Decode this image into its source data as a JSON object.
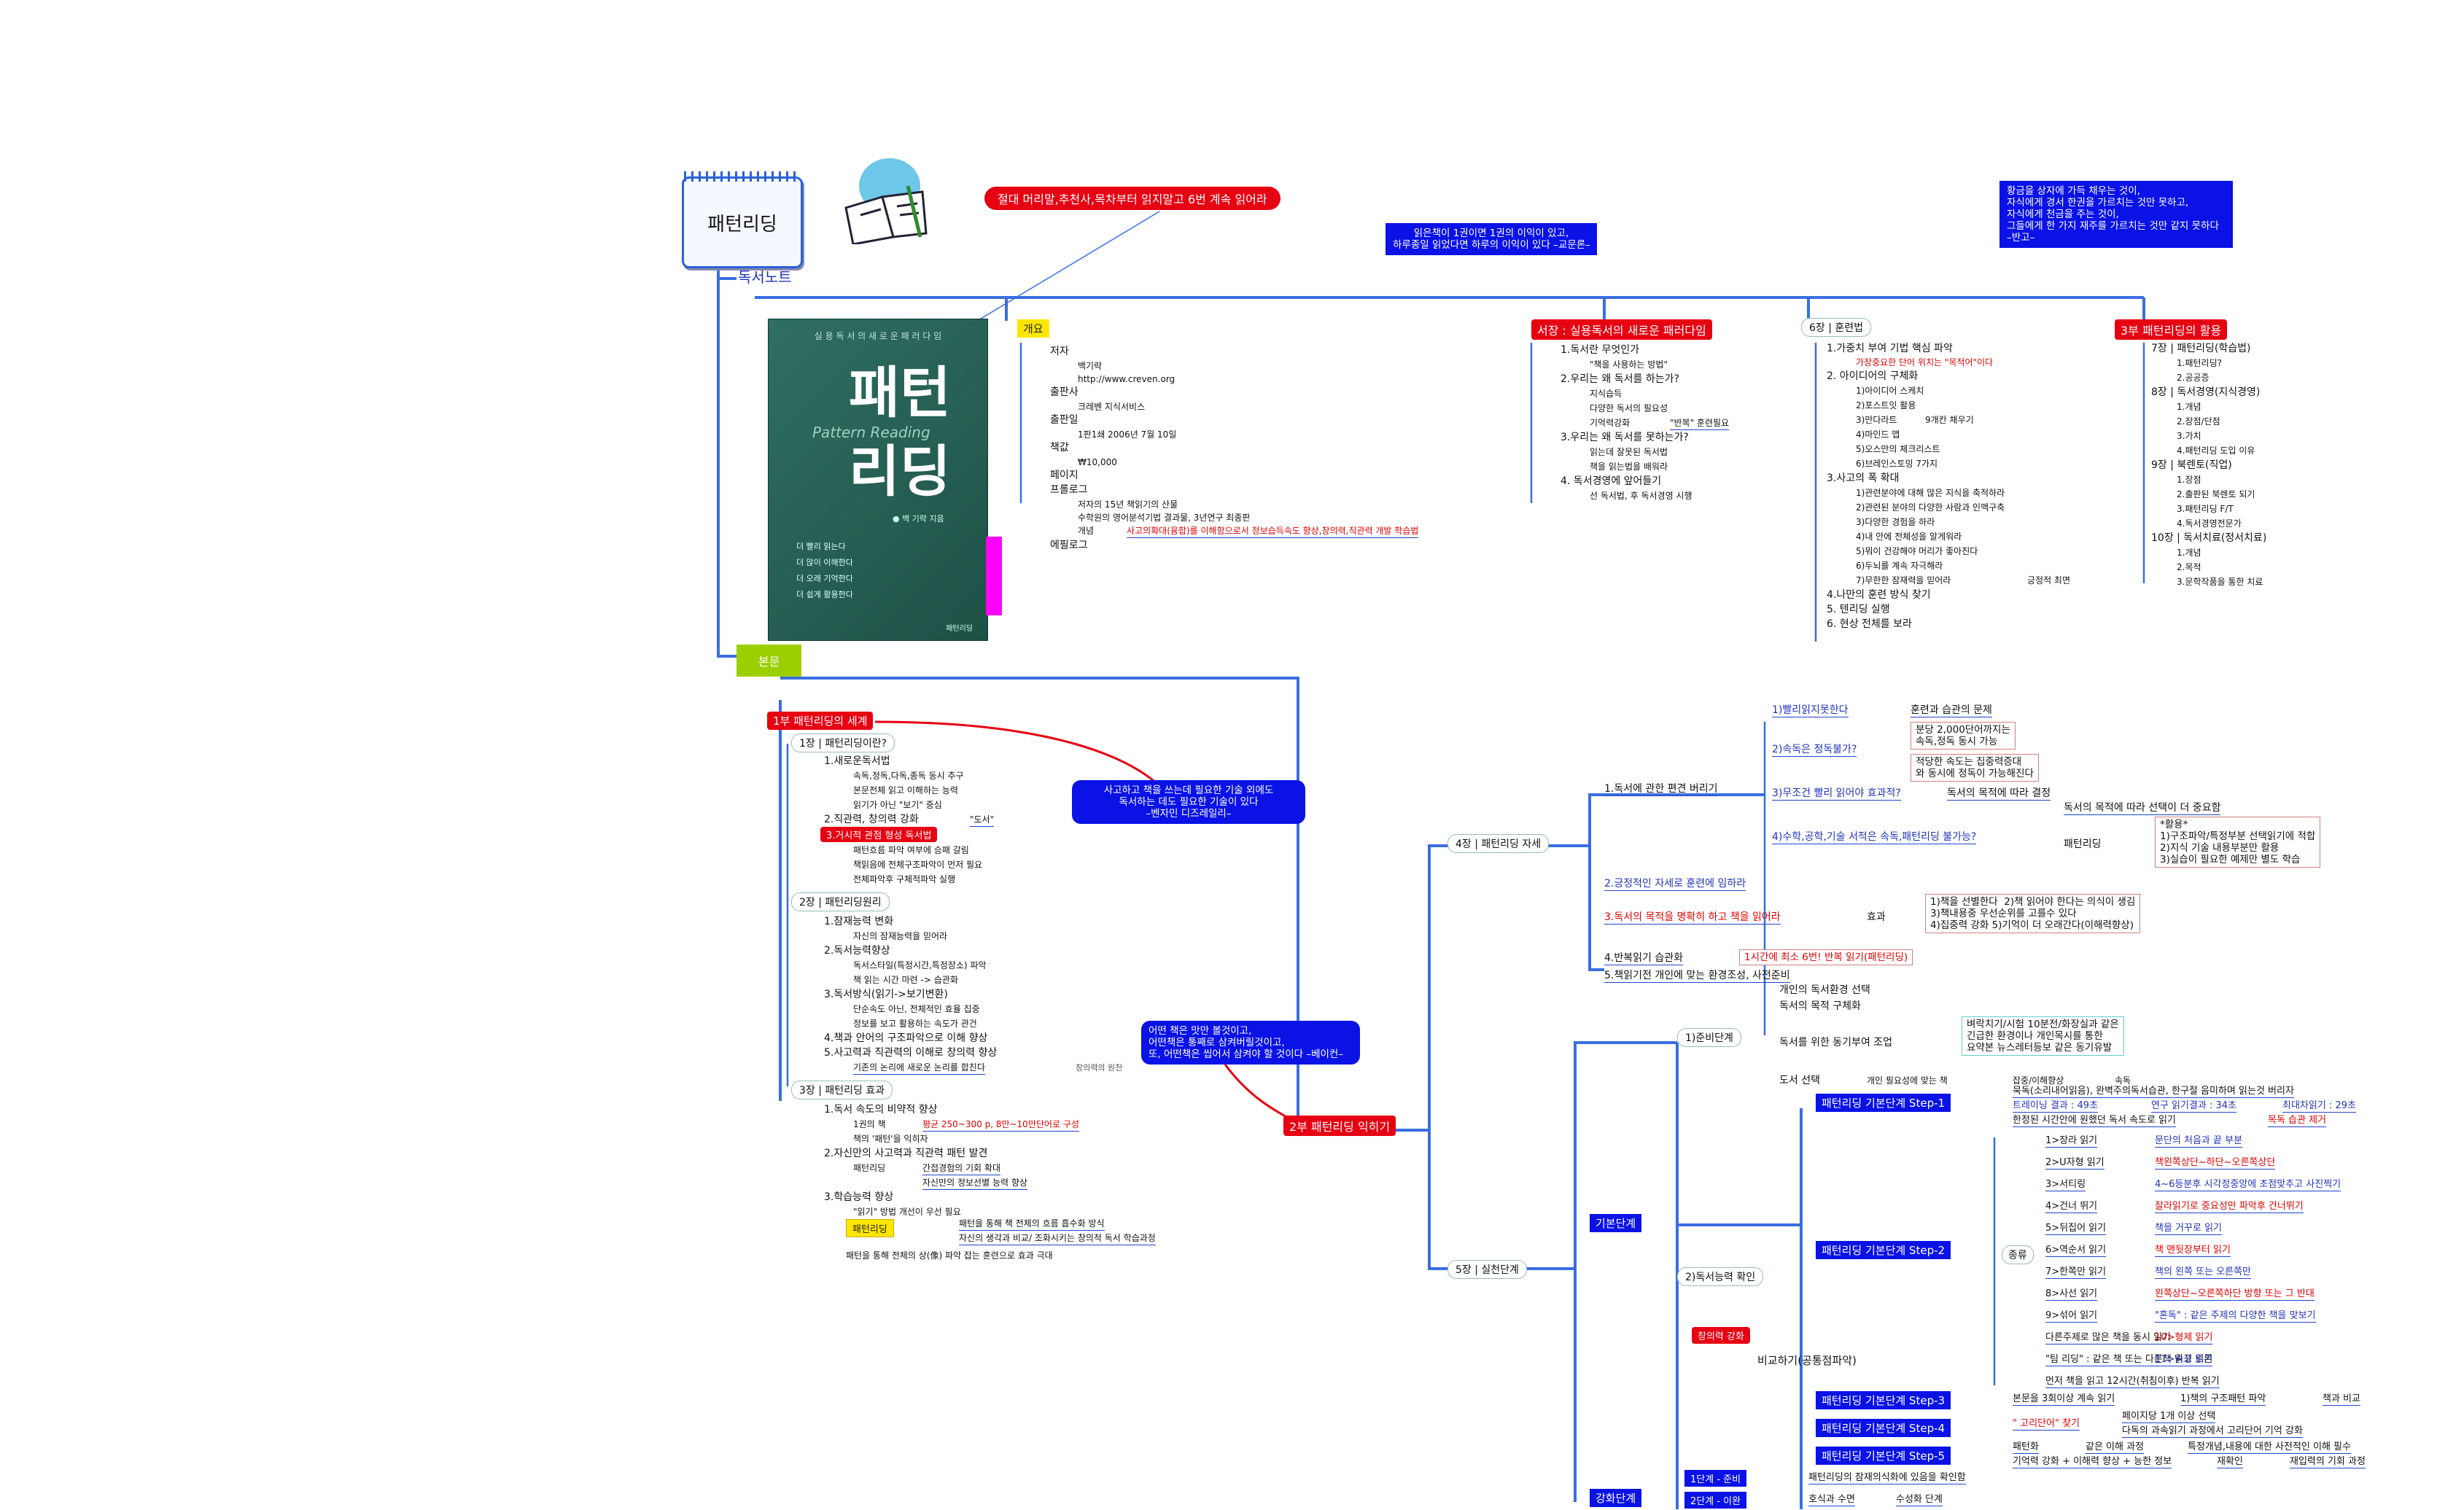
{
  "root": {
    "title": "패턴리딩",
    "child": "독서노트",
    "main": "본문"
  },
  "top_notes": {
    "red_banner": "절대 머리말,추천사,목차부터 읽지말고 6번 계속 읽어라",
    "blue_quote1": "읽은책이 1권이면 1권의 이익이 있고,\n하루종일 읽었다면 하루의 이익이 있다 –교문론–",
    "blue_quote2": "황금을 상자에 가득 채우는 것이,\n자식에게 경서 한권을 가르치는 것만 못하고,\n자식에게 천금을 주는 것이,\n그들에게 한 가지 재주를 가르치는 것만 같지 못하다\n–반고–"
  },
  "book": {
    "top": "실 용 독 서 의 새 로 운 패 러 다 임",
    "title1": "패턴",
    "title2": "리딩",
    "english": "Pattern Reading",
    "author": "● 백 기락 지음",
    "bullets": [
      "더 빨리 읽는다",
      "더 많이 이해한다",
      "더 오래 기억한다",
      "더 쉽게 활용한다"
    ],
    "publisher": "패턴리딩"
  },
  "overview": {
    "label": "개요",
    "items": [
      "저자",
      "백기락",
      "http://www.creven.org",
      "출판사",
      "크레벤 지식서비스",
      "출판일",
      "1판1쇄 2006년 7월 10일",
      "책값",
      "₩10,000",
      "페이지",
      "프롤로그",
      "저자의 15년 책읽기의 산물",
      "수학원의 영어분석기법 결과물, 3년연구 최종판",
      "개념",
      "사고의확대(융합)를 이해함으로서 정보습득속도 향상,창의력,직관력 개발 학습법",
      "에필로그"
    ]
  },
  "intro": {
    "label": "서장 : 실용독서의 새로운 패러다임",
    "items": [
      "1.독서란 무엇인가",
      "\"책을 사용하는 방법\"",
      "2.우리는 왜 독서를 하는가?",
      "지식습득",
      "다양한 독서의 필요성",
      "기억력강화",
      "\"반복\" 훈련필요",
      "3.우리는 왜 독서를 못하는가?",
      "읽는데 잘못된 독서법",
      "책을 읽는법을 배워라",
      "4. 독서경영에 앞어들기",
      "선 독서법, 후 독서경영 시행"
    ]
  },
  "ch6": {
    "label": "6장 | 훈련법",
    "items": [
      "1.가중치 부여 기법 핵심 파악",
      "가장중요한 단어 위치는 \"목적어\"이다",
      "2. 아이디어의 구체화",
      "1)아이디어 스케치",
      "2)포스트잇 활용",
      "3)만다라트",
      "9개칸 채우기",
      "4)마인드 맵",
      "5)오스만의 체크리스트",
      "6)브레인스토밍 7가지",
      "3.사고의 폭 확대",
      "1)관련분야에 대해 많은 지식을 축적하라",
      "2)관련된 분야의 다양한 사람과 인맥구축",
      "3)다양한 경험을 하라",
      "4)내 안에 전체성을 알게워라",
      "5)뭐이 건강해야 머리가 좋아진다",
      "6)두뇌를 계속 자극해라",
      "7)무한한 잠재력을 믿어라",
      "긍정적 최면",
      "4.나만의 훈련 방식 찾기",
      "5. 텐리딩 실행",
      "6. 현상 전체를 보라"
    ]
  },
  "part3": {
    "label": "3부 패턴리딩의 활용",
    "items": [
      "7장 | 패턴리딩(학습법)",
      "1.패턴리딩?",
      "2.공공증",
      "8장 | 독서경영(지식경영)",
      "1.개념",
      "2.장점/단점",
      "3.가치",
      "4.패턴리딩 도입 이유",
      "9장 | 북렌토(직업)",
      "1.장점",
      "2.출판된 북렌토 되기",
      "3.패턴리딩 F/T",
      "4.독서경영전문가",
      "10장 | 독서치료(정서치료)",
      "1.개념",
      "2.목적",
      "3.문학작품을 통한 치료"
    ]
  },
  "part1": {
    "label": "1부 패턴리딩의 세계",
    "ch1": "1장 | 패턴리딩이란?",
    "ch1_items": [
      "1.새로운독서법",
      "속독,정독,다독,종독 동시 추구",
      "본문전체 읽고 이해하는 능력",
      "읽기가 아닌 \"보기\" 중심",
      "2.직관력, 창의력 강화",
      "\"도서\"",
      "3.거시적 관점 형성 독서법",
      "패턴흐름 파악 여부에 승패 갈림",
      "책읽음에 전체구조파악이 먼저 필요",
      "전체파악후 구체적파악 실행"
    ],
    "ch2": "2장 | 패턴리딩원리",
    "ch2_items": [
      "1.잠재능력 변화",
      "자신의 잠재능력을 믿어라",
      "2.독서능력향상",
      "독서스타일(특정시간,특정장소) 파악",
      "책 읽는 시간 마련 -> 습관화",
      "3.독서방식(읽기->보기변환)",
      "단순속도 아닌, 전체적인 효율 집중",
      "정보를 보고 활용하는 속도가 관건",
      "4.책과 안어의 구조파악으로 이해 향상",
      "5.사고력과 직관력의 이해로 창의력 향상",
      "기존의 논리에 새로운 논리를 합친다",
      "창의력의 원천"
    ],
    "ch3": "3장 | 패턴리딩 효과",
    "ch3_items": [
      "1.독서 속도의 비약적 향상",
      "1권의 책",
      "평균 250~300 p, 8만~10만단어로 구성",
      "책의 '패턴'을 익히자",
      "2.자신만의 사고력과 직관력 패턴 발견",
      "패턴리딩",
      "간접경험의 기회 확대",
      "자신만의 정보선별 능력 향상",
      "3.학습능력 향상",
      "\"읽기\" 방법 개선이 우선 필요",
      "패턴리딩",
      "패턴을 통해 책 전체의 흐름 흡수화 방식",
      "자신의 생각과 비교/ 조화시키는 창의적 독서 학습과정",
      "패턴을 통해 전체의 상(像) 파악 잡는 훈련으로 효과 극대"
    ]
  },
  "mid_notes": {
    "quote_a": "사고하고 책을 쓰는데 필요한 기술 외에도\n독서하는 데도 필요한 기술이 있다\n–벤자민 디즈레일리–",
    "quote_b": "어떤 책은 맛만 볼것이고,\n어떤책은 통째로 삼켜버릴것이고,\n또, 어떤책은 씹어서 삼켜야 할 것이다 –베이컨–"
  },
  "part2": {
    "label": "2부 패턴리딩 익히기"
  },
  "ch4": {
    "label": "4장 | 패턴리딩 자세",
    "b1": "1.독서에 관한 편견 버리기",
    "b1_items": [
      "1)빨리읽지못한다",
      "훈련과 습관의 문제",
      "2)속독은 정독불가?",
      "3)무조건 빨리 읽어야 효과적?",
      "독서의 목적에 따라 결정",
      "4)수학,공학,기술 서적은 속독,패턴리딩 불가능?",
      "독서의 목적에 따라 선택이 더 중요함",
      "패턴리딩"
    ],
    "box1": "분당 2,000단어까지는\n속독,정독 동시 가능",
    "box2": "적당한 속도는 집중력증대\n와 동시에 정독이 가능해진다",
    "box3": "*활용*\n1)구조파악/특정부분 선택읽기에 적합\n2)지식 기술 내용부분만 활용\n3)실습이 필요한 예제만 별도 학습",
    "b2": "2.긍정적인 자세로 훈련에 임하라",
    "b3": "3.독서의 목적을 명확히 하고 책을 읽어라",
    "b3_effect": "효과",
    "box4": "1)책을 선별한다  2)책 읽어야 한다는 의식이 생김\n3)책내용중 우선순위를 고를수 있다\n4)집중력 강화 5)기억이 더 오래간다(이해력향상)",
    "b4": "4.반복읽기 습관화",
    "b4_box": "1시간에 최소 6번! 반복 읽기(패턴리딩)",
    "b5": "5.책읽기전 개인에 맞는 환경조성, 사전준비"
  },
  "ch5": {
    "label": "5장 | 실천단계",
    "prep": "1)준비단계",
    "prep_items": [
      "개인의 독서환경 선택",
      "독서의 목적 구체화",
      "독서를 위한 동기부여 조업",
      "도서 선택",
      "개인 필요성에 맞는 책",
      "잡중/이해향상",
      "속독"
    ],
    "prep_box": "벼락치기/시험 10분전/화장실과 같은\n긴급한 환경이나 개인목시를 통한\n요약본 뉴스레터등보 같은 동기유발",
    "basic": "기본단계",
    "skill": "2)독서능력 확인",
    "s1": "패턴리딩 기본단계 Step-1",
    "s1_items": [
      "묵독(소리내어읽음), 완벽주의독서습관, 한구절 음미하며 읽는것 버리자",
      "트레이닝 결과 : 49초",
      "연구 읽기결과 : 34초",
      "최대차읽기 : 29초",
      "한정된 시간안에 원했던 독서 속도로 읽기",
      "목독 습관 제거"
    ],
    "s2": "패턴리딩 기본단계 Step-2",
    "s2_kind": "종류",
    "s2_items": [
      "1>장라 읽기",
      "문단의 처음과 끝 부분",
      "2>U자형 읽기",
      "책왼쪽상단~하단~오른쪽상단",
      "3>서티링",
      "4~6등분후 시각정중앙에 초점맞추고 사진찍기",
      "4>건너 뛰기",
      "잘라읽기로 중요성만 파악후 건너뛰기",
      "5>뒤집어 읽기",
      "책을 거꾸로 읽기",
      "6>역순서 읽기",
      "책 맨뒷장부터 읽기",
      "7>한쪽만 읽기",
      "책의 왼쪽 또는 오른쪽만",
      "8>사선 읽기",
      "왼쪽상단~오른쪽하단 방향 또는 그 반대",
      "9>섞어 읽기",
      "\"혼독\" : 같은 주제의 다양한 책을 맞보기",
      "다른주제로 많은 책을 동시 읽기",
      "10>형제 읽기",
      "\"팀 리딩\" : 같은 책 또는 다른책 읽고 토론",
      "11>속성 읽기",
      "먼저 책을 읽고 12시간(취침이후) 반복 읽기"
    ],
    "creative": "창의력 강화",
    "compare": "비교하기(공통점파악)",
    "s3": "패턴리딩 기본단계 Step-3",
    "s3_items": [
      "본문을 3회이상 계속 읽기",
      "1)책의 구조패턴 파악",
      "책과 비교"
    ],
    "s4": "패턴리딩 기본단계 Step-4",
    "s4_items": [
      "\" 고리단어\" 찾기",
      "페이지당 1개 이상 선택",
      "다독의 과속읽기 과정에서 고리단어 기억 강화"
    ],
    "s5": "패턴리딩 기본단계 Step-5",
    "s5_items": [
      "패턴화",
      "같은 이해 과정",
      "특정개념,내용에 대한 사전적인 이해 필수",
      "기억력 강화 + 이해력 향상 + 능한 정보",
      "재확인",
      "재입력의 기회 과정"
    ],
    "adv": "강화단계",
    "adv_items": [
      "1단계 - 준비",
      "패턴리딩의 잠재의식화에 있음을 확인함",
      "2단계 - 이완",
      "호식과 수면",
      "수성화 단계"
    ]
  },
  "colors": {
    "red": "#e60012",
    "blue": "#0a12e6",
    "link": "#2a62d8",
    "yellow": "#ffe600",
    "lime": "#9dcf00"
  }
}
